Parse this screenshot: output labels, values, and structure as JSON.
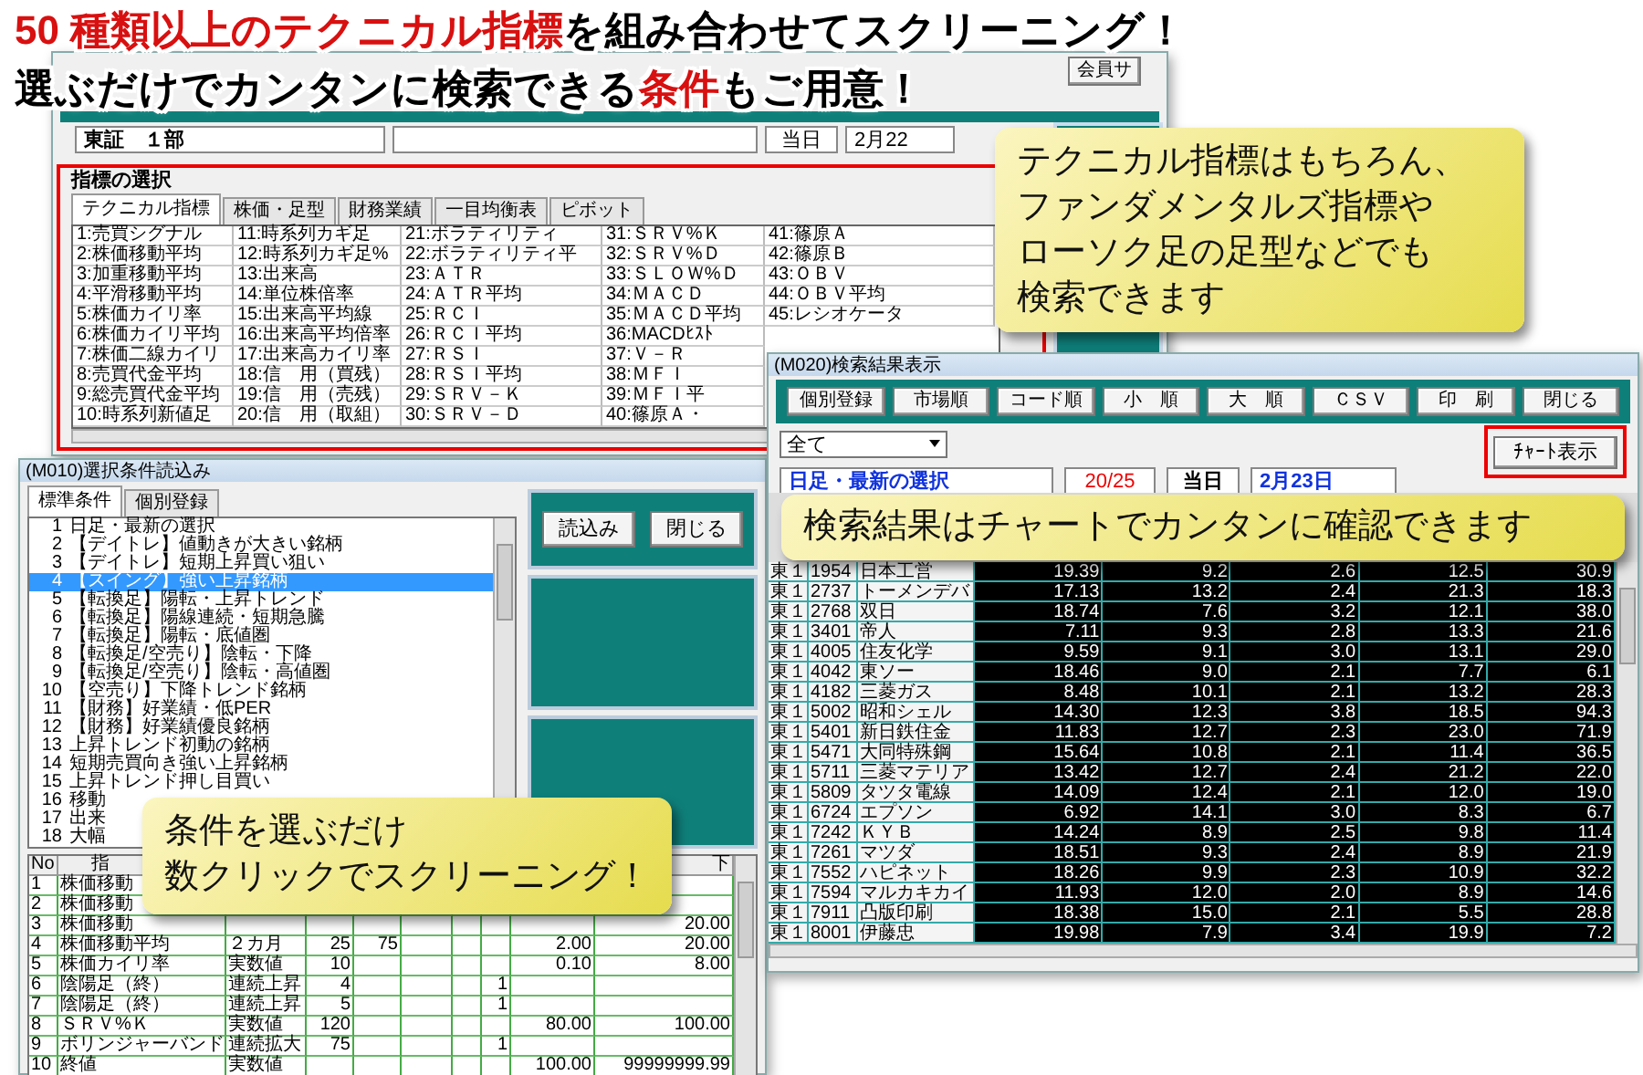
{
  "headline": {
    "lines": [
      [
        {
          "text": "50 種類以上のテクニカル指標",
          "highlight": true
        },
        {
          "text": "を組み合わせてスクリーニング！",
          "highlight": false
        }
      ],
      [
        {
          "text": "選ぶだけでカンタンに検索できる",
          "highlight": false
        },
        {
          "text": "条件",
          "highlight": true
        },
        {
          "text": "もご用意！",
          "highlight": false
        }
      ]
    ]
  },
  "indicator_window": {
    "toolbar_button": "会員サ",
    "market": "東証　１部",
    "today_label": "当日",
    "date": "2月22",
    "section_title": "指標の選択",
    "highlighted": true,
    "tabs": [
      {
        "label": "テクニカル指標",
        "selected": true
      },
      {
        "label": "株価・足型",
        "selected": false
      },
      {
        "label": "財務業績",
        "selected": false
      },
      {
        "label": "一目均衡表",
        "selected": false
      },
      {
        "label": "ピボット",
        "selected": false
      }
    ],
    "indicator_columns": [
      [
        "1:売買シグナル",
        "2:株価移動平均",
        "3:加重移動平均",
        "4:平滑移動平均",
        "5:株価カイリ率",
        "6:株価カイリ平均",
        "7:株価二線カイリ",
        "8:売買代金平均",
        "9:総売買代金平均",
        "10:時系列新値足"
      ],
      [
        "11:時系列カギ足",
        "12:時系列カギ足%",
        "13:出来高",
        "14:単位株倍率",
        "15:出来高平均線",
        "16:出来高平均倍率",
        "17:出来高カイリ率",
        "18:信　用（買残）",
        "19:信　用（売残）",
        "20:信　用（取組）"
      ],
      [
        "21:ボラティリティ",
        "22:ボラティリティ平",
        "23:ＡＴＲ",
        "24:ＡＴＲ平均",
        "25:ＲＣＩ",
        "26:ＲＣＩ平均",
        "27:ＲＳＩ",
        "28:ＲＳＩ平均",
        "29:ＳＲＶ－Ｋ",
        "30:ＳＲＶ－Ｄ"
      ],
      [
        "31:ＳＲＶ%Ｋ",
        "32:ＳＲＶ%Ｄ",
        "33:ＳＬＯＷ%Ｄ",
        "34:ＭＡＣＤ",
        "35:ＭＡＣＤ平均",
        "36:MACDﾋｽﾄ",
        "37:Ｖ－Ｒ",
        "38:ＭＦＩ",
        "39:ＭＦＩ平",
        "40:篠原Ａ・"
      ],
      [
        "41:篠原Ａ",
        "42:篠原Ｂ",
        "43:ＯＢＶ",
        "44:ＯＢＶ平均",
        "45:レシオケータ"
      ]
    ]
  },
  "condition_window": {
    "title": "(M010)選択条件読込み",
    "tabs": [
      {
        "label": "標準条件",
        "selected": true
      },
      {
        "label": "個別登録",
        "selected": false
      }
    ],
    "conditions": [
      {
        "number": "1",
        "label": "日足・最新の選択",
        "selected": false
      },
      {
        "number": "2",
        "label": "【デイトレ】値動きが大きい銘柄",
        "selected": false
      },
      {
        "number": "3",
        "label": "【デイトレ】短期上昇買い狙い",
        "selected": false
      },
      {
        "number": "4",
        "label": "【スイング】強い上昇銘柄",
        "selected": true
      },
      {
        "number": "5",
        "label": "【転換足】陽転・上昇トレンド",
        "selected": false
      },
      {
        "number": "6",
        "label": "【転換足】陽線連続・短期急騰",
        "selected": false
      },
      {
        "number": "7",
        "label": "【転換足】陽転・底値圏",
        "selected": false
      },
      {
        "number": "8",
        "label": "【転換足/空売り】陰転・下降",
        "selected": false
      },
      {
        "number": "9",
        "label": "【転換足/空売り】陰転・高値圏",
        "selected": false
      },
      {
        "number": "10",
        "label": "【空売り】下降トレンド銘柄",
        "selected": false
      },
      {
        "number": "11",
        "label": "【財務】好業績・低PER",
        "selected": false
      },
      {
        "number": "12",
        "label": "【財務】好業績優良銘柄",
        "selected": false
      },
      {
        "number": "13",
        "label": "上昇トレンド初動の銘柄",
        "selected": false
      },
      {
        "number": "14",
        "label": "短期売買向き強い上昇銘柄",
        "selected": false
      },
      {
        "number": "15",
        "label": "上昇トレンド押し目買い",
        "selected": false
      },
      {
        "number": "16",
        "label": "移動",
        "selected": false
      },
      {
        "number": "17",
        "label": "出来",
        "selected": false
      },
      {
        "number": "18",
        "label": "大幅",
        "selected": false
      }
    ],
    "buttons": [
      "読込み",
      "閉じる"
    ],
    "table": {
      "header": [
        "No",
        "指",
        "下"
      ],
      "rows": [
        [
          "1",
          "株価移動",
          null,
          null,
          null,
          null,
          null,
          null,
          null,
          null
        ],
        [
          "2",
          "株価移動",
          null,
          null,
          null,
          null,
          null,
          null,
          null,
          null
        ],
        [
          "3",
          "株価移動",
          null,
          null,
          null,
          null,
          null,
          null,
          null,
          "20.00"
        ],
        [
          "4",
          "株価移動平均",
          "２カ月",
          "25",
          "75",
          null,
          null,
          null,
          "2.00",
          "20.00"
        ],
        [
          "5",
          "株価カイリ率",
          "実数値",
          "10",
          null,
          null,
          null,
          null,
          "0.10",
          "8.00"
        ],
        [
          "6",
          "陰陽足（終）",
          "連続上昇",
          "4",
          null,
          null,
          null,
          "1",
          null,
          null
        ],
        [
          "7",
          "陰陽足（終）",
          "連続上昇",
          "5",
          null,
          null,
          null,
          "1",
          null,
          null
        ],
        [
          "8",
          "ＳＲＶ%Ｋ",
          "実数値",
          "120",
          null,
          null,
          null,
          null,
          "80.00",
          "100.00"
        ],
        [
          "9",
          "ボリンジャーバンド",
          "連続拡大",
          "75",
          null,
          null,
          null,
          "1",
          null,
          null
        ],
        [
          "10",
          "終値",
          "実数値",
          null,
          null,
          null,
          null,
          null,
          "100.00",
          "99999999.99"
        ]
      ]
    }
  },
  "result_window": {
    "title": "(M020)検索結果表示",
    "toolbar_buttons": [
      "個別登録",
      "市場順",
      "コード順",
      "小　順",
      "大　順",
      "ＣＳＶ",
      "印　刷",
      "閉じる"
    ],
    "filter": "全て",
    "chart_button": "ﾁｬｰﾄ表示",
    "chart_button_highlighted": true,
    "condition_name": "日足・最新の選択",
    "count": "20/25",
    "today_label": "当日",
    "date": "2月23日",
    "rows": [
      {
        "market": "東１",
        "code": "1954",
        "name": "日本工営",
        "values": [
          "19.39",
          "9.2",
          "2.6",
          "12.5",
          "30.9"
        ]
      },
      {
        "market": "東１",
        "code": "2737",
        "name": "トーメンデバ",
        "values": [
          "17.13",
          "13.2",
          "2.4",
          "21.3",
          "18.3"
        ]
      },
      {
        "market": "東１",
        "code": "2768",
        "name": "双日",
        "values": [
          "18.74",
          "7.6",
          "3.2",
          "12.1",
          "38.0"
        ]
      },
      {
        "market": "東１",
        "code": "3401",
        "name": "帝人",
        "values": [
          "7.11",
          "9.3",
          "2.8",
          "13.3",
          "21.6"
        ]
      },
      {
        "market": "東１",
        "code": "4005",
        "name": "住友化学",
        "values": [
          "9.59",
          "9.1",
          "3.0",
          "13.1",
          "29.0"
        ]
      },
      {
        "market": "東１",
        "code": "4042",
        "name": "東ソー",
        "values": [
          "18.46",
          "9.0",
          "2.1",
          "7.7",
          "6.1"
        ]
      },
      {
        "market": "東１",
        "code": "4182",
        "name": "三菱ガス",
        "values": [
          "8.48",
          "10.1",
          "2.1",
          "13.2",
          "28.3"
        ]
      },
      {
        "market": "東１",
        "code": "5002",
        "name": "昭和シェル",
        "values": [
          "14.30",
          "12.3",
          "3.8",
          "18.5",
          "94.3"
        ]
      },
      {
        "market": "東１",
        "code": "5401",
        "name": "新日鉄住金",
        "values": [
          "11.83",
          "12.7",
          "2.3",
          "23.0",
          "71.9"
        ]
      },
      {
        "market": "東１",
        "code": "5471",
        "name": "大同特殊鋼",
        "values": [
          "15.64",
          "10.8",
          "2.1",
          "11.4",
          "36.5"
        ]
      },
      {
        "market": "東１",
        "code": "5711",
        "name": "三菱マテリア",
        "values": [
          "13.42",
          "12.7",
          "2.4",
          "21.2",
          "22.0"
        ]
      },
      {
        "market": "東１",
        "code": "5809",
        "name": "タツタ電線",
        "values": [
          "14.09",
          "12.4",
          "2.1",
          "12.0",
          "19.0"
        ]
      },
      {
        "market": "東１",
        "code": "6724",
        "name": "エプソン",
        "values": [
          "6.92",
          "14.1",
          "3.0",
          "8.3",
          "6.7"
        ]
      },
      {
        "market": "東１",
        "code": "7242",
        "name": "ＫＹＢ",
        "values": [
          "14.24",
          "8.9",
          "2.5",
          "9.8",
          "11.4"
        ]
      },
      {
        "market": "東１",
        "code": "7261",
        "name": "マツダ",
        "values": [
          "18.51",
          "9.3",
          "2.4",
          "8.9",
          "21.9"
        ]
      },
      {
        "market": "東１",
        "code": "7552",
        "name": "ハピネット",
        "values": [
          "18.26",
          "9.9",
          "2.3",
          "10.9",
          "32.2"
        ]
      },
      {
        "market": "東１",
        "code": "7594",
        "name": "マルカキカイ",
        "values": [
          "11.93",
          "12.0",
          "2.0",
          "8.9",
          "14.6"
        ]
      },
      {
        "market": "東１",
        "code": "7911",
        "name": "凸版印刷",
        "values": [
          "18.38",
          "15.0",
          "2.1",
          "5.5",
          "28.8"
        ]
      },
      {
        "market": "東１",
        "code": "8001",
        "name": "伊藤忠",
        "values": [
          "19.98",
          "7.9",
          "3.4",
          "19.9",
          "7.2"
        ]
      }
    ]
  },
  "callouts": [
    {
      "lines": [
        "テクニカル指標はもちろん、",
        "ファンダメンタルズ指標や",
        "ローソク足の足型などでも",
        "検索できます"
      ]
    },
    {
      "lines": [
        "検索結果はチャートでカンタンに確認できます"
      ]
    },
    {
      "lines": [
        "条件を選ぶだけ",
        "数クリックでスクリーニング！"
      ]
    }
  ]
}
